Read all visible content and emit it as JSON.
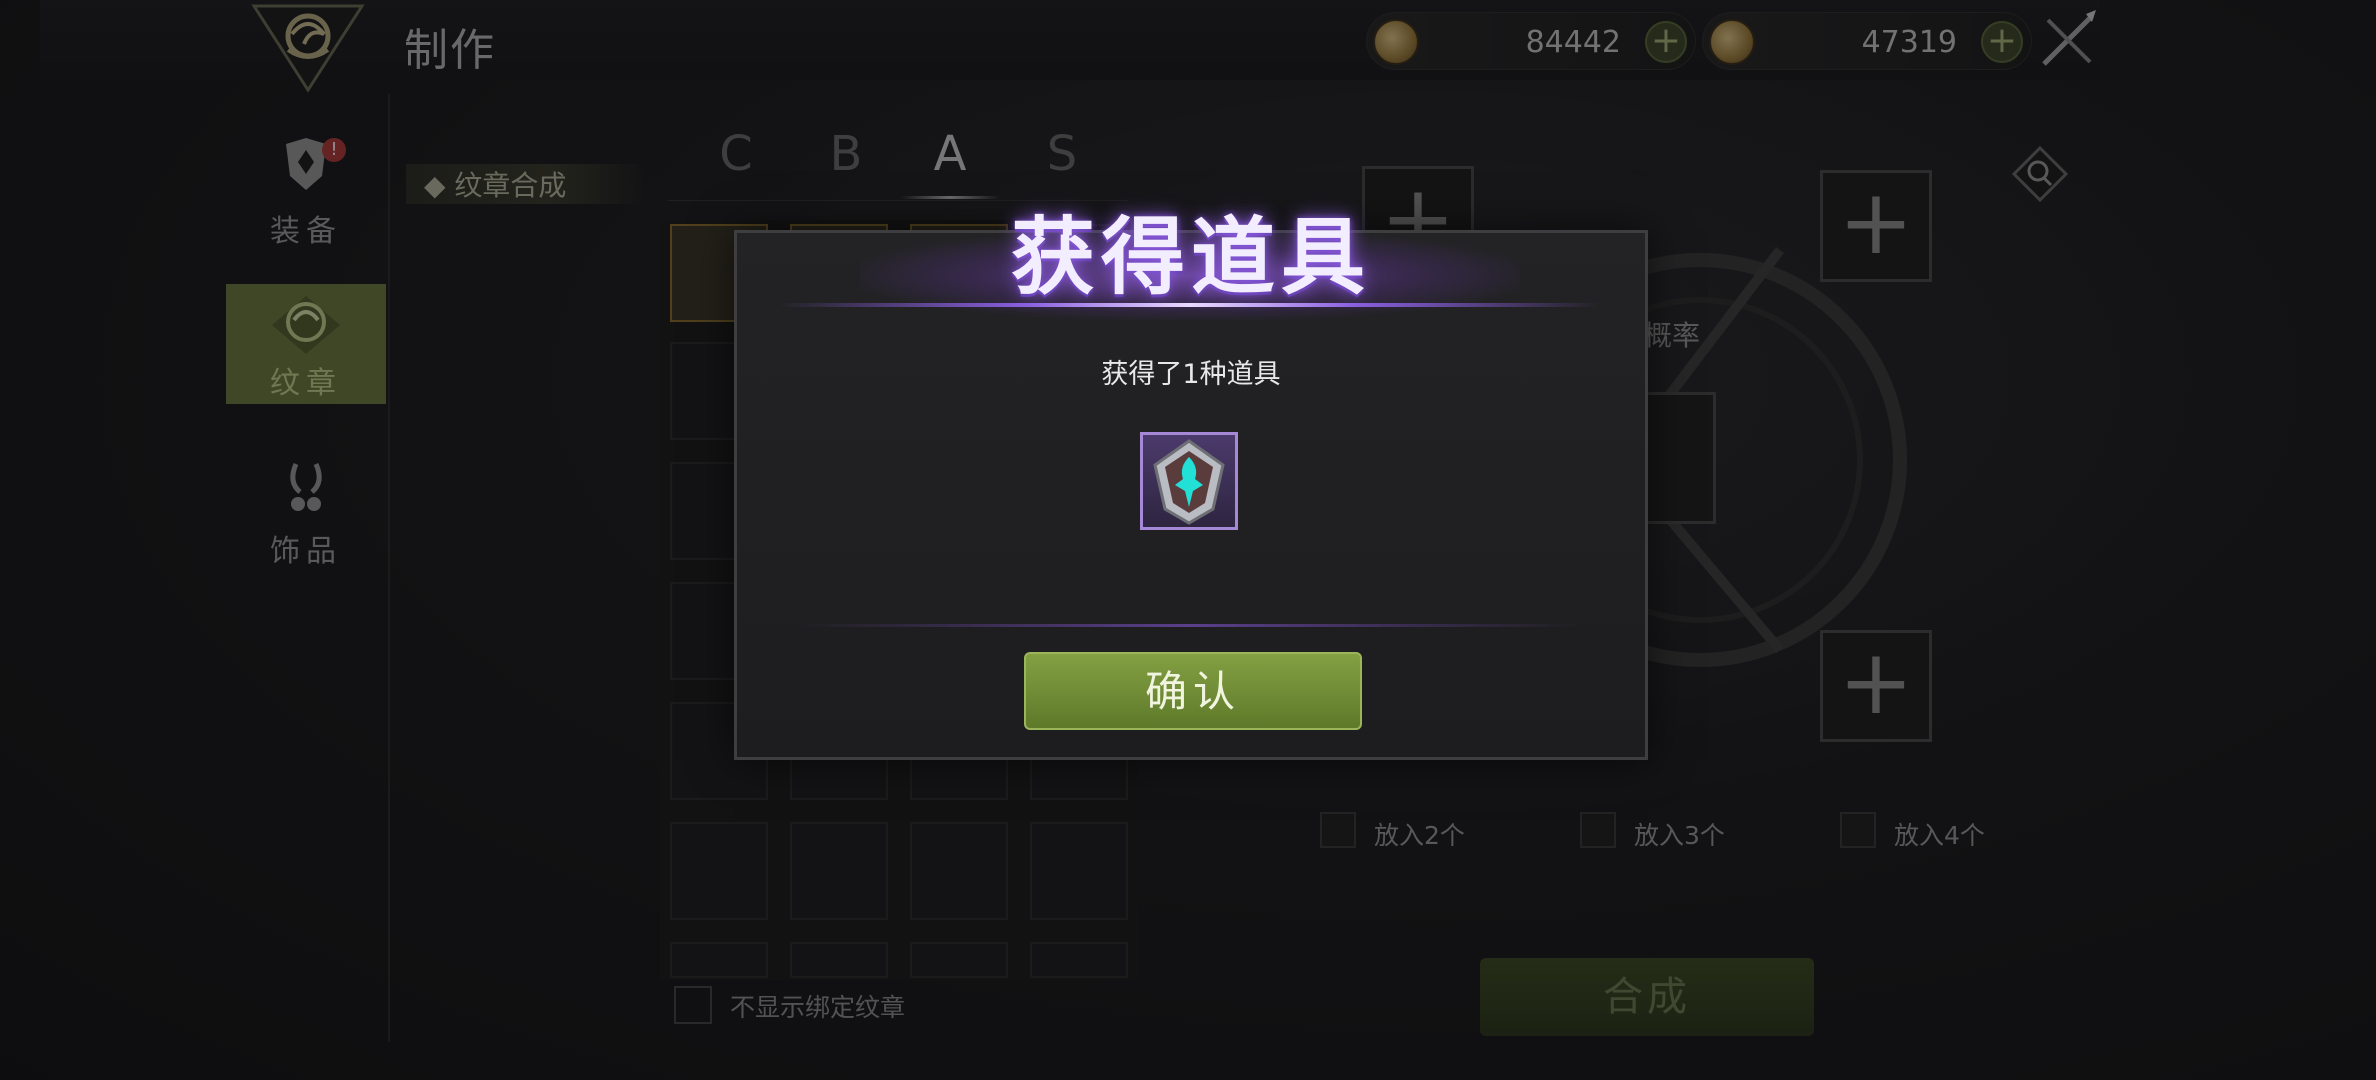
{
  "header": {
    "title": "制作",
    "currency_1": "84442",
    "currency_2": "47319",
    "plus_label": "+"
  },
  "sidebar": {
    "items": [
      {
        "label": "装备",
        "badge": "!"
      },
      {
        "label": "纹章"
      },
      {
        "label": "饰品"
      }
    ]
  },
  "subtab": {
    "label": "◆ 纹章合成"
  },
  "grades": [
    "C",
    "B",
    "A",
    "S"
  ],
  "options": [
    "放入2个",
    "放入3个",
    "放入4个"
  ],
  "grid_footer": {
    "no_bind_label": "不显示绑定纹章"
  },
  "craft_panel": {
    "probability_label": "概率",
    "synth_button": "合成",
    "slot_plus": "+"
  },
  "modal": {
    "title": "获得道具",
    "message": "获得了1种道具",
    "confirm": "确认"
  },
  "colors": {
    "accent_green": "#6d7a3c",
    "modal_purple": "#8f5fe0"
  }
}
